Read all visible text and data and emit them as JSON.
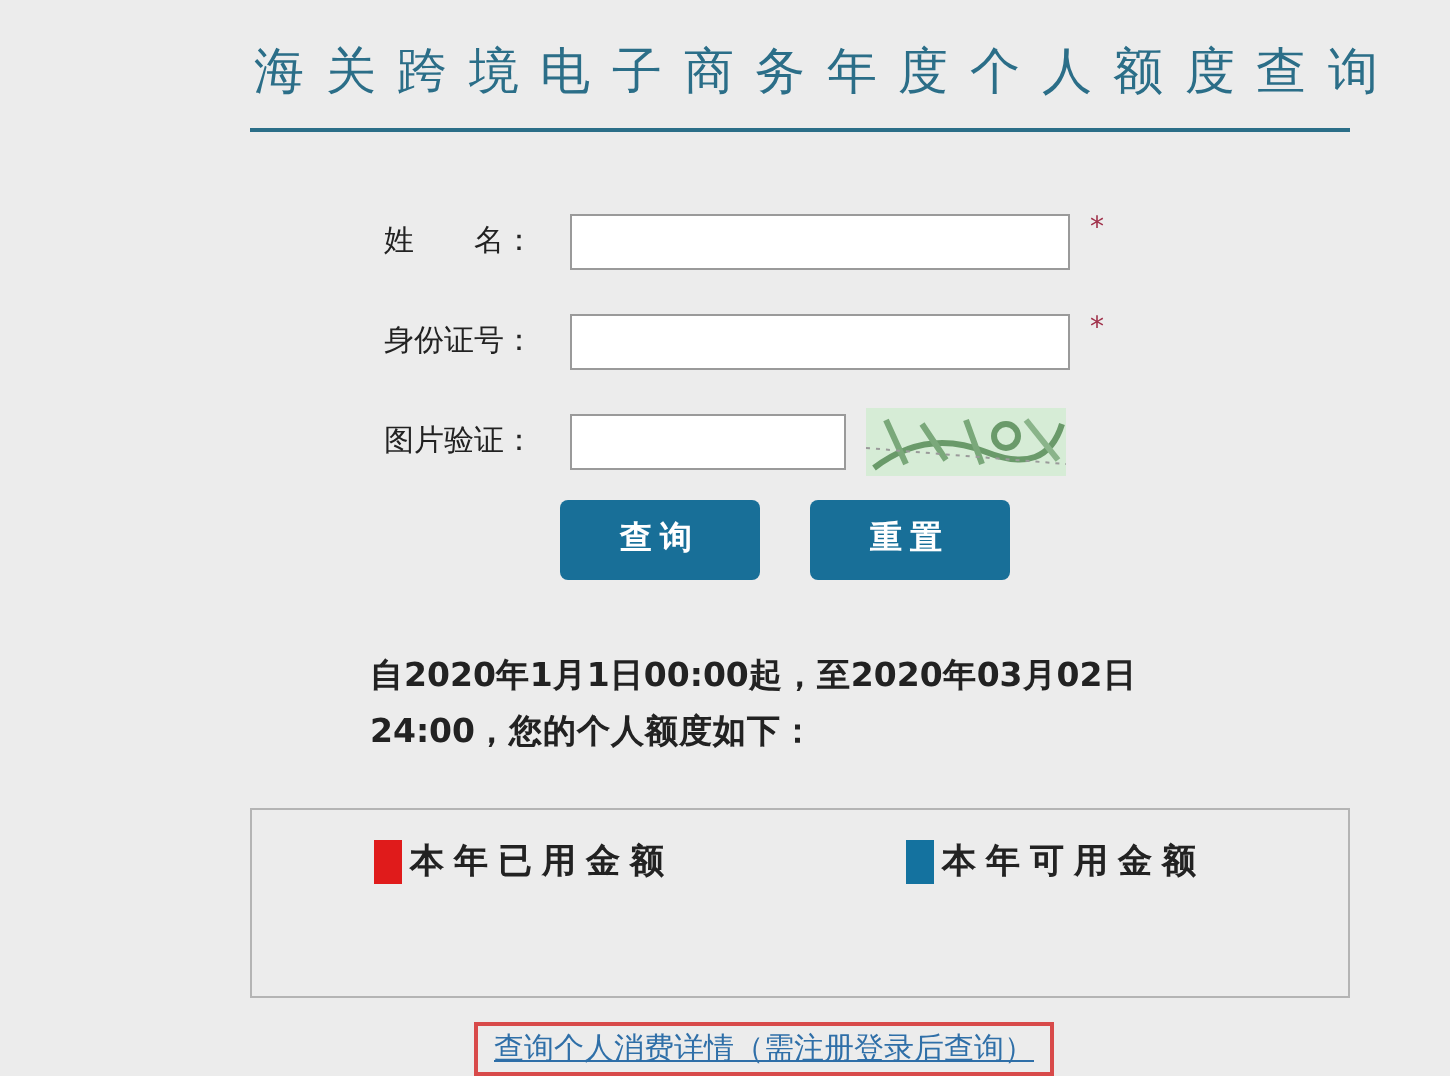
{
  "title": "海关跨境电子商务年度个人额度查询",
  "fields": [
    {
      "label": "姓　　名：",
      "required_marker": "*"
    },
    {
      "label": "身份证号：",
      "required_marker": "*"
    },
    {
      "label": "图片验证：",
      "kind": "captcha"
    }
  ],
  "buttons": [
    "查询",
    "重置"
  ],
  "notice": "自2020年1月1日00:00起，至2020年03月02日24:00，您的个人额度如下：",
  "legend": [
    {
      "label": "本年已用金额",
      "color": "#e01b1b"
    },
    {
      "label": "本年可用金额",
      "color": "#14729f"
    }
  ],
  "link": {
    "label": "查询个人消费详情（需注册登录后查询）",
    "highlighted": true
  }
}
